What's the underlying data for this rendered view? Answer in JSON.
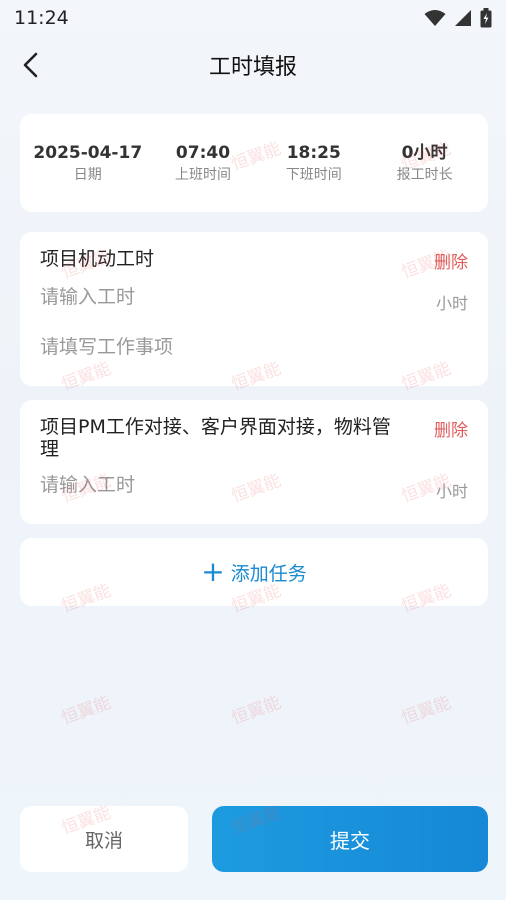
{
  "status_bar": {
    "time": "11:24"
  },
  "nav": {
    "title": "工时填报"
  },
  "summary": [
    {
      "value": "2025-04-17",
      "label": "日期"
    },
    {
      "value": "07:40",
      "label": "上班时间"
    },
    {
      "value": "18:25",
      "label": "下班时间"
    },
    {
      "value": "0小时",
      "label": "报工时长"
    }
  ],
  "tasks": [
    {
      "title": "项目机动工时",
      "delete_label": "删除",
      "hours_placeholder": "请输入工时",
      "unit": "小时",
      "work_placeholder": "请填写工作事项"
    },
    {
      "title": "项目PM工作对接、客户界面对接，物料管理",
      "delete_label": "删除",
      "hours_placeholder": "请输入工时",
      "unit": "小时"
    }
  ],
  "add_task": {
    "label": "添加任务"
  },
  "actions": {
    "cancel": "取消",
    "submit": "提交"
  },
  "watermark": {
    "text": "恒翼能"
  },
  "colors": {
    "accent": "#1a8ad1",
    "danger": "#e15a5a"
  }
}
